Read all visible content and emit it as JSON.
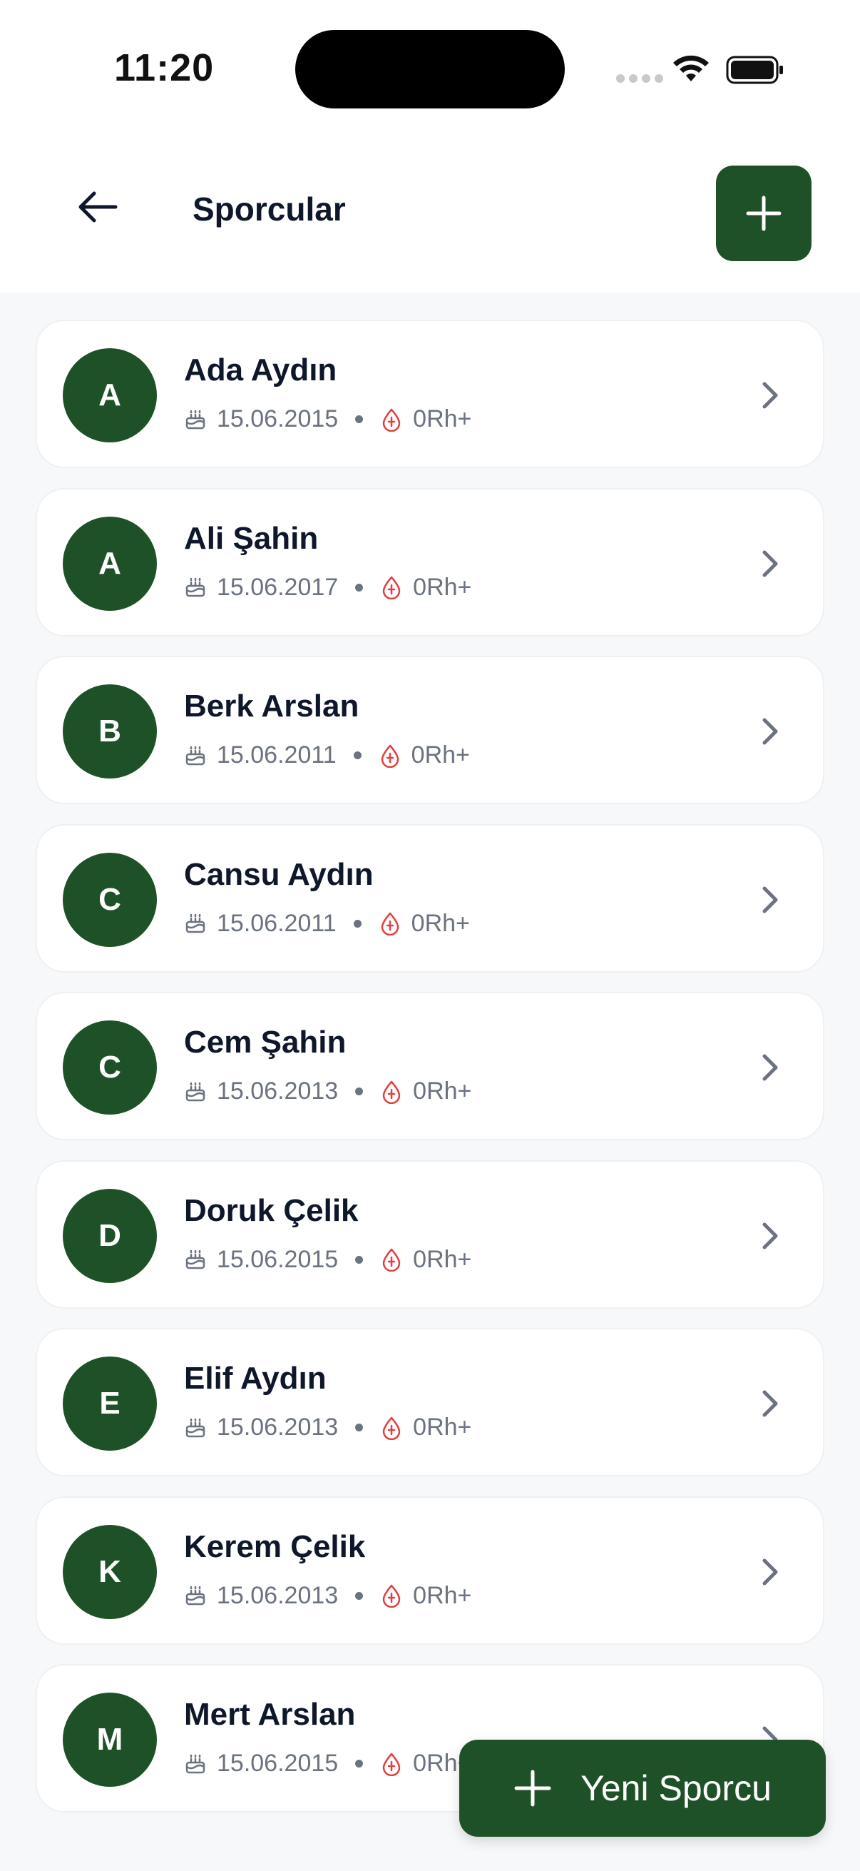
{
  "status_bar": {
    "time": "11:20"
  },
  "header": {
    "title": "Sporcular"
  },
  "athletes": [
    {
      "initial": "A",
      "name": "Ada Aydın",
      "birth_date": "15.06.2015",
      "blood_type": "0Rh+"
    },
    {
      "initial": "A",
      "name": "Ali Şahin",
      "birth_date": "15.06.2017",
      "blood_type": "0Rh+"
    },
    {
      "initial": "B",
      "name": "Berk Arslan",
      "birth_date": "15.06.2011",
      "blood_type": "0Rh+"
    },
    {
      "initial": "C",
      "name": "Cansu Aydın",
      "birth_date": "15.06.2011",
      "blood_type": "0Rh+"
    },
    {
      "initial": "C",
      "name": "Cem Şahin",
      "birth_date": "15.06.2013",
      "blood_type": "0Rh+"
    },
    {
      "initial": "D",
      "name": "Doruk Çelik",
      "birth_date": "15.06.2015",
      "blood_type": "0Rh+"
    },
    {
      "initial": "E",
      "name": "Elif Aydın",
      "birth_date": "15.06.2013",
      "blood_type": "0Rh+"
    },
    {
      "initial": "K",
      "name": "Kerem Çelik",
      "birth_date": "15.06.2013",
      "blood_type": "0Rh+"
    },
    {
      "initial": "M",
      "name": "Mert Arslan",
      "birth_date": "15.06.2015",
      "blood_type": "0Rh+"
    }
  ],
  "fab": {
    "label": "Yeni Sporcu"
  },
  "colors": {
    "brand_green": "#1f5128",
    "blood_red": "#e53e3e",
    "muted": "#6b7280"
  }
}
